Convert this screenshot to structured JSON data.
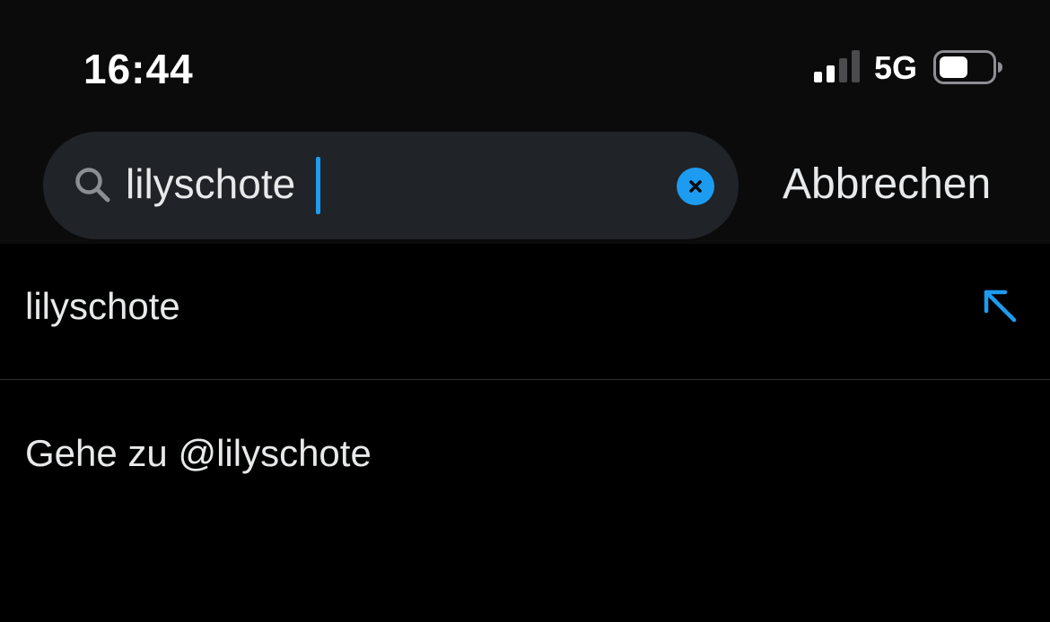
{
  "status_bar": {
    "time": "16:44",
    "network": "5G",
    "signal_bars_active": 2,
    "signal_bars_total": 4,
    "battery_level": 0.55,
    "icons": [
      "signal-icon",
      "battery-icon"
    ]
  },
  "search": {
    "query": "lilyschote",
    "cancel_label": "Abbrechen",
    "icons": [
      "search-icon",
      "clear-icon"
    ]
  },
  "results": {
    "suggestion": "lilyschote",
    "goto_label": "Gehe zu @lilyschote",
    "icons": [
      "arrow-up-left-icon"
    ]
  },
  "colors": {
    "accent": "#1d9bf0",
    "background": "#000000",
    "header_background": "#0b0b0c",
    "search_background": "#202327",
    "text": "#e7e9ea",
    "divider": "#2f3336"
  }
}
